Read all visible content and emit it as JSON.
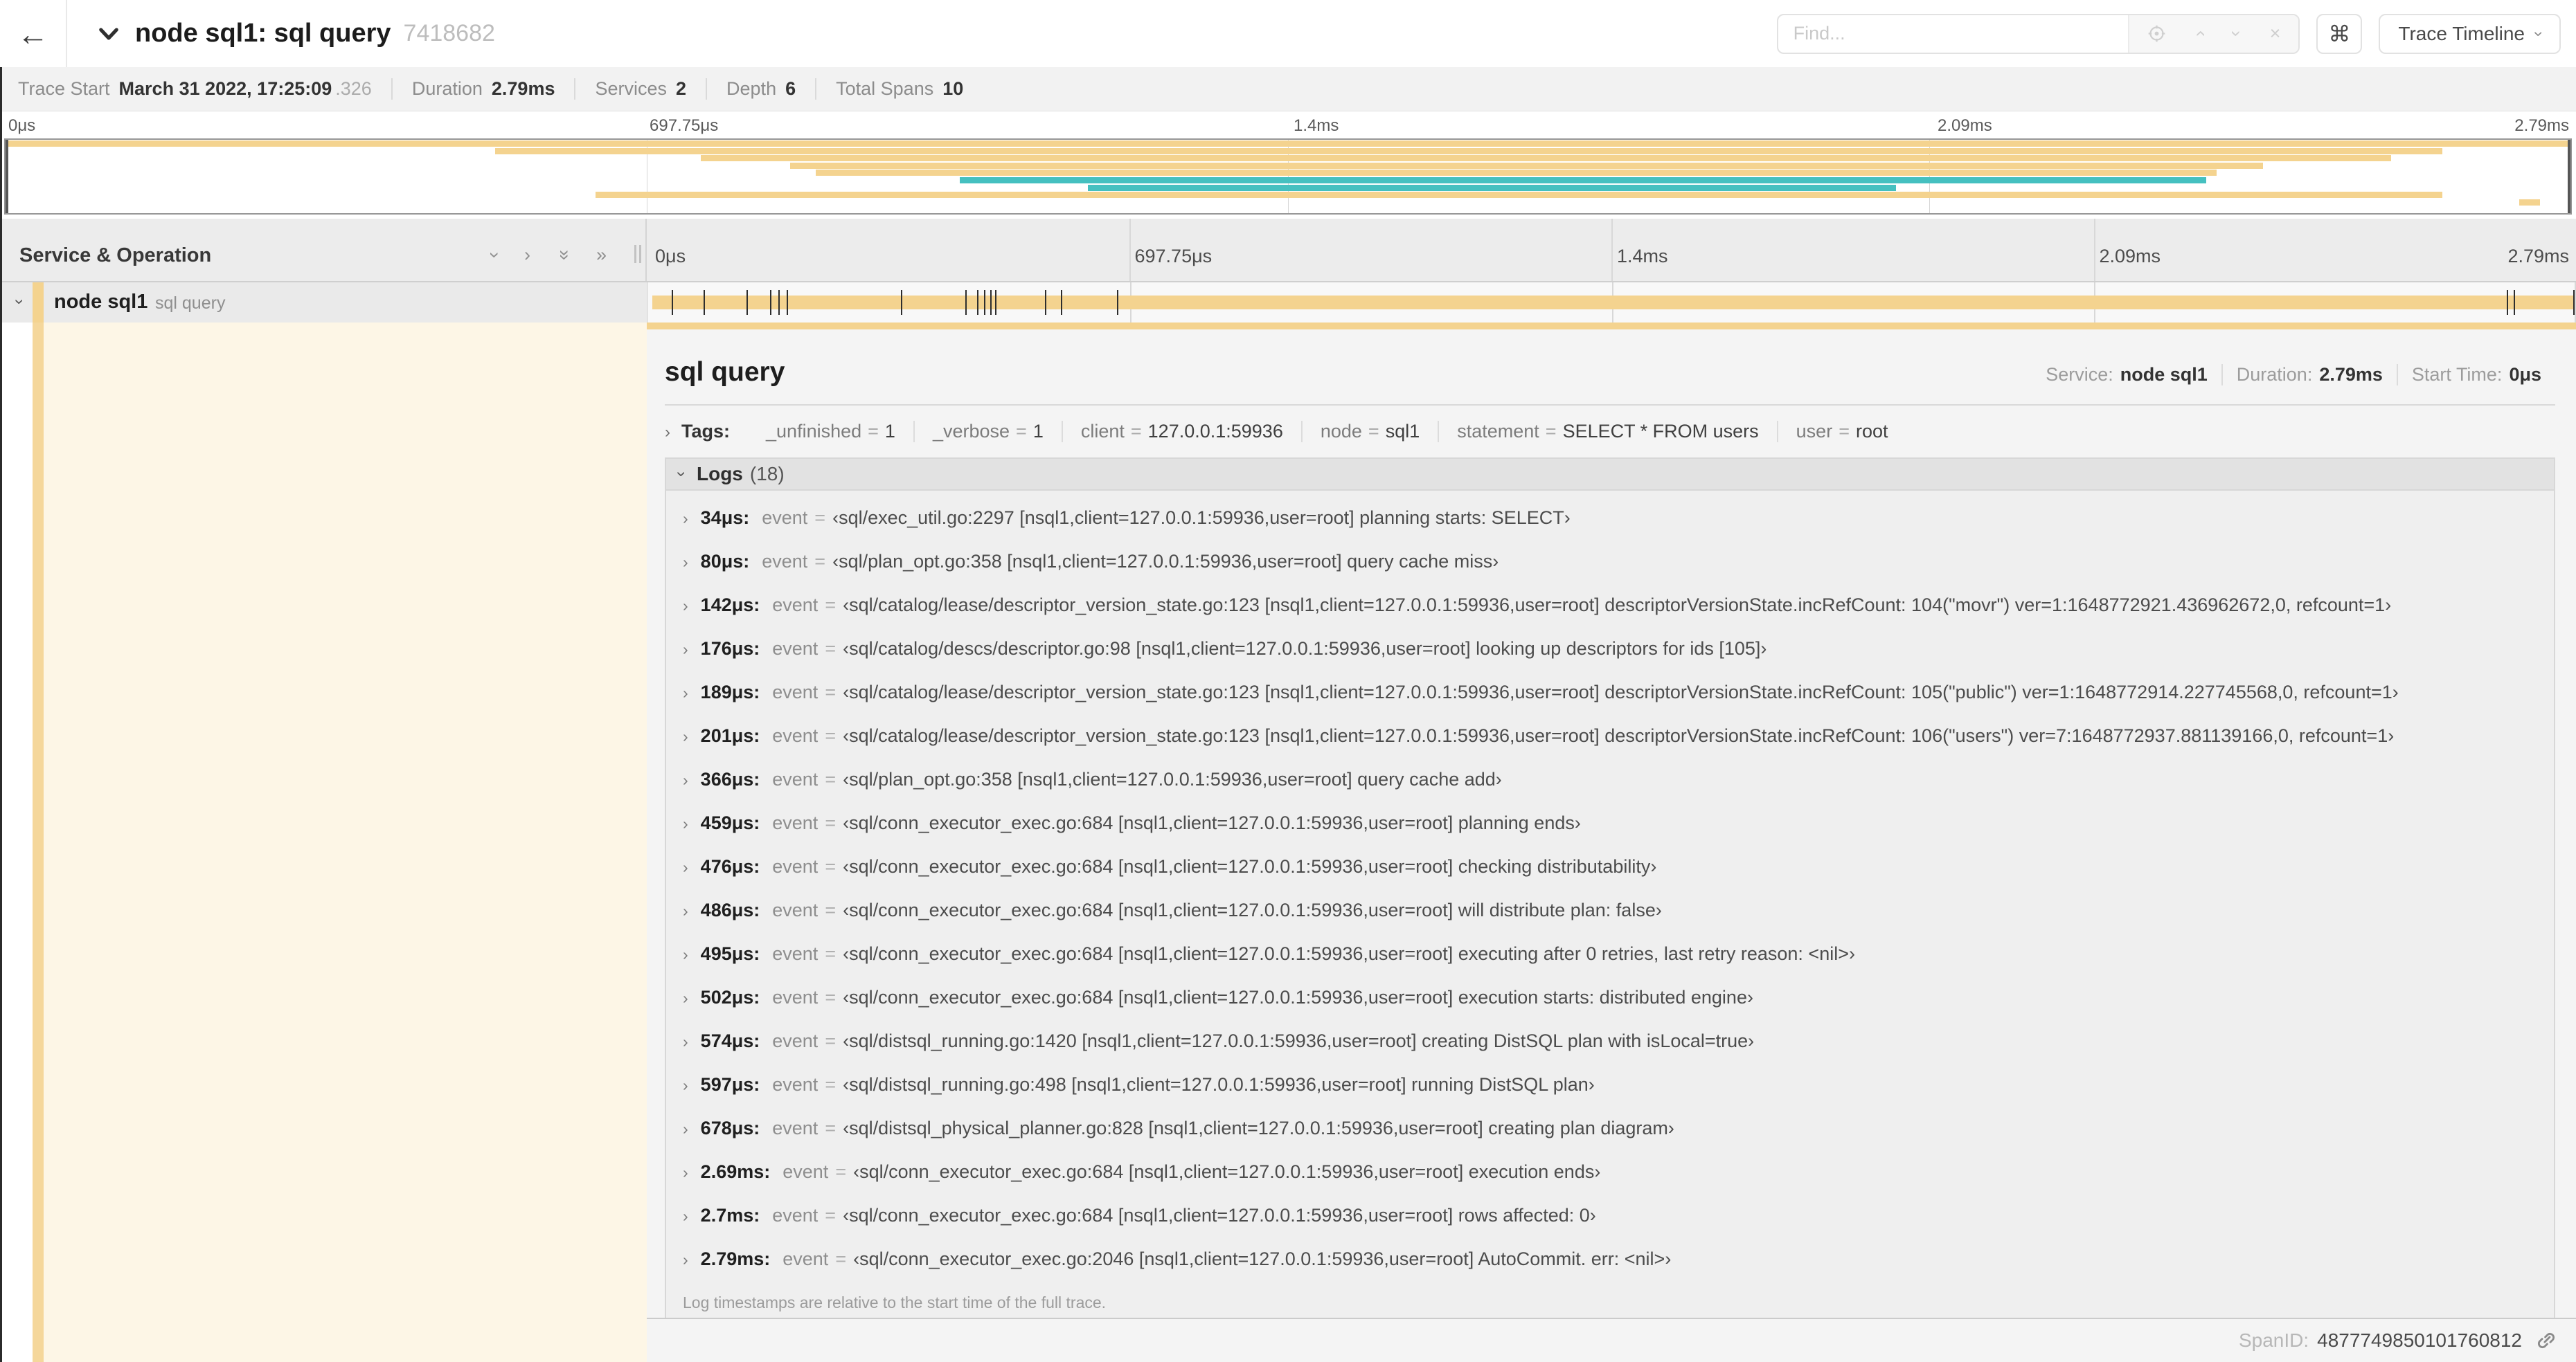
{
  "colors": {
    "span_tan": "#f4d38f",
    "span_teal": "#45c0c0",
    "cream": "#fdf6e6",
    "stripe": "#f5d79b"
  },
  "header": {
    "back_icon": "←",
    "title": "node sql1: sql query",
    "trace_id": "7418682",
    "find_placeholder": "Find...",
    "shortcut_icon": "⌘",
    "view_selector": "Trace Timeline"
  },
  "trace_info": [
    {
      "label": "Trace Start",
      "value": "March 31 2022, 17:25:09",
      "suffix": ".326"
    },
    {
      "label": "Duration",
      "value": "2.79ms",
      "suffix": ""
    },
    {
      "label": "Services",
      "value": "2",
      "suffix": ""
    },
    {
      "label": "Depth",
      "value": "6",
      "suffix": ""
    },
    {
      "label": "Total Spans",
      "value": "10",
      "suffix": ""
    }
  ],
  "timeline": {
    "column_header": "Service & Operation",
    "ticks": [
      "0μs",
      "697.75μs",
      "1.4ms",
      "2.09ms",
      "2.79ms"
    ],
    "minimap_spans": [
      {
        "row": 0,
        "left": 0,
        "width": 100,
        "color": "span_tan"
      },
      {
        "row": 1,
        "left": 19.1,
        "width": 75.9,
        "color": "span_tan"
      },
      {
        "row": 2,
        "left": 27.1,
        "width": 65.9,
        "color": "span_tan"
      },
      {
        "row": 3,
        "left": 30.6,
        "width": 57.4,
        "color": "span_tan"
      },
      {
        "row": 4,
        "left": 31.6,
        "width": 54.6,
        "color": "span_tan"
      },
      {
        "row": 5,
        "left": 37.2,
        "width": 48.6,
        "color": "span_teal"
      },
      {
        "row": 6,
        "left": 42.2,
        "width": 31.5,
        "color": "span_teal"
      },
      {
        "row": 7,
        "left": 23.0,
        "width": 72.0,
        "color": "span_tan"
      },
      {
        "row": 8,
        "left": 98.0,
        "width": 0.8,
        "color": "span_tan"
      }
    ],
    "span_row": {
      "service": "node sql1",
      "operation": "sql query",
      "log_marks_pct": [
        1.22,
        2.87,
        5.09,
        6.31,
        6.77,
        7.2,
        13.12,
        16.45,
        17.06,
        17.42,
        17.74,
        17.99,
        20.57,
        21.4,
        24.3,
        96.42,
        96.77,
        99.85
      ]
    }
  },
  "detail": {
    "title": "sql query",
    "meta": [
      {
        "label": "Service:",
        "value": "node sql1"
      },
      {
        "label": "Duration:",
        "value": "2.79ms"
      },
      {
        "label": "Start Time:",
        "value": "0μs"
      }
    ],
    "tags_label": "Tags:",
    "tags": [
      {
        "key": "_unfinished",
        "value": "1"
      },
      {
        "key": "_verbose",
        "value": "1"
      },
      {
        "key": "client",
        "value": "127.0.0.1:59936"
      },
      {
        "key": "node",
        "value": "sql1"
      },
      {
        "key": "statement",
        "value": "SELECT * FROM users"
      },
      {
        "key": "user",
        "value": "root"
      }
    ],
    "logs_label": "Logs",
    "logs_count": "(18)",
    "logs": [
      {
        "time": "34μs:",
        "key": "event",
        "value": "‹sql/exec_util.go:2297 [nsql1,client=127.0.0.1:59936,user=root] planning starts: SELECT›"
      },
      {
        "time": "80μs:",
        "key": "event",
        "value": "‹sql/plan_opt.go:358 [nsql1,client=127.0.0.1:59936,user=root] query cache miss›"
      },
      {
        "time": "142μs:",
        "key": "event",
        "value": "‹sql/catalog/lease/descriptor_version_state.go:123 [nsql1,client=127.0.0.1:59936,user=root] descriptorVersionState.incRefCount: 104(\"movr\") ver=1:1648772921.436962672,0, refcount=1›"
      },
      {
        "time": "176μs:",
        "key": "event",
        "value": "‹sql/catalog/descs/descriptor.go:98 [nsql1,client=127.0.0.1:59936,user=root] looking up descriptors for ids [105]›"
      },
      {
        "time": "189μs:",
        "key": "event",
        "value": "‹sql/catalog/lease/descriptor_version_state.go:123 [nsql1,client=127.0.0.1:59936,user=root] descriptorVersionState.incRefCount: 105(\"public\") ver=1:1648772914.227745568,0, refcount=1›"
      },
      {
        "time": "201μs:",
        "key": "event",
        "value": "‹sql/catalog/lease/descriptor_version_state.go:123 [nsql1,client=127.0.0.1:59936,user=root] descriptorVersionState.incRefCount: 106(\"users\") ver=7:1648772937.881139166,0, refcount=1›"
      },
      {
        "time": "366μs:",
        "key": "event",
        "value": "‹sql/plan_opt.go:358 [nsql1,client=127.0.0.1:59936,user=root] query cache add›"
      },
      {
        "time": "459μs:",
        "key": "event",
        "value": "‹sql/conn_executor_exec.go:684 [nsql1,client=127.0.0.1:59936,user=root] planning ends›"
      },
      {
        "time": "476μs:",
        "key": "event",
        "value": "‹sql/conn_executor_exec.go:684 [nsql1,client=127.0.0.1:59936,user=root] checking distributability›"
      },
      {
        "time": "486μs:",
        "key": "event",
        "value": "‹sql/conn_executor_exec.go:684 [nsql1,client=127.0.0.1:59936,user=root] will distribute plan: false›"
      },
      {
        "time": "495μs:",
        "key": "event",
        "value": "‹sql/conn_executor_exec.go:684 [nsql1,client=127.0.0.1:59936,user=root] executing after 0 retries, last retry reason: <nil>›"
      },
      {
        "time": "502μs:",
        "key": "event",
        "value": "‹sql/conn_executor_exec.go:684 [nsql1,client=127.0.0.1:59936,user=root] execution starts: distributed engine›"
      },
      {
        "time": "574μs:",
        "key": "event",
        "value": "‹sql/distsql_running.go:1420 [nsql1,client=127.0.0.1:59936,user=root] creating DistSQL plan with isLocal=true›"
      },
      {
        "time": "597μs:",
        "key": "event",
        "value": "‹sql/distsql_running.go:498 [nsql1,client=127.0.0.1:59936,user=root] running DistSQL plan›"
      },
      {
        "time": "678μs:",
        "key": "event",
        "value": "‹sql/distsql_physical_planner.go:828 [nsql1,client=127.0.0.1:59936,user=root] creating plan diagram›"
      },
      {
        "time": "2.69ms:",
        "key": "event",
        "value": "‹sql/conn_executor_exec.go:684 [nsql1,client=127.0.0.1:59936,user=root] execution ends›"
      },
      {
        "time": "2.7ms:",
        "key": "event",
        "value": "‹sql/conn_executor_exec.go:684 [nsql1,client=127.0.0.1:59936,user=root] rows affected: 0›"
      },
      {
        "time": "2.79ms:",
        "key": "event",
        "value": "‹sql/conn_executor_exec.go:2046 [nsql1,client=127.0.0.1:59936,user=root] AutoCommit. err: <nil>›"
      }
    ],
    "logs_note": "Log timestamps are relative to the start time of the full trace.",
    "span_id_label": "SpanID:",
    "span_id": "4877749850101760812"
  }
}
